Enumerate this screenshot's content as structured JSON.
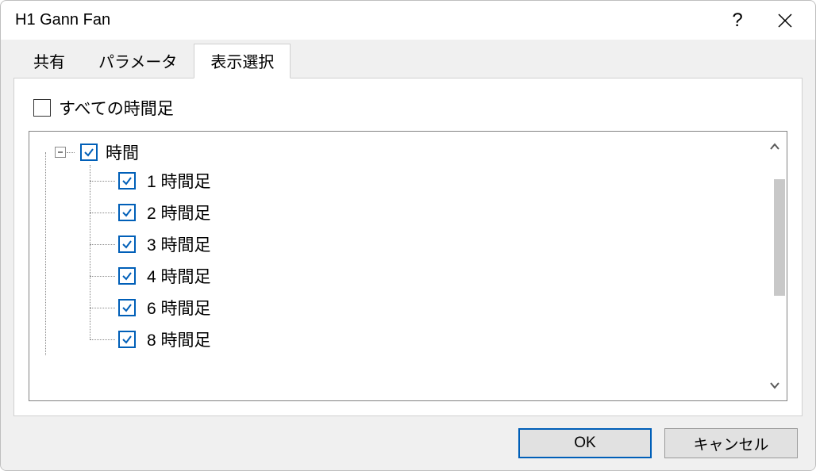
{
  "window": {
    "title": "H1 Gann Fan"
  },
  "tabs": {
    "share": "共有",
    "params": "パラメータ",
    "display": "表示選択"
  },
  "active_tab": "display",
  "panel": {
    "all_timeframes_label": "すべての時間足",
    "all_timeframes_checked": false,
    "tree": {
      "root_label": "時間",
      "root_checked": true,
      "expanded": true,
      "items": [
        {
          "label": "1 時間足",
          "checked": true
        },
        {
          "label": "2 時間足",
          "checked": true
        },
        {
          "label": "3 時間足",
          "checked": true
        },
        {
          "label": "4 時間足",
          "checked": true
        },
        {
          "label": "6 時間足",
          "checked": true
        },
        {
          "label": "8 時間足",
          "checked": true
        }
      ]
    }
  },
  "buttons": {
    "ok": "OK",
    "cancel": "キャンセル"
  },
  "colors": {
    "accent": "#005fb8"
  }
}
